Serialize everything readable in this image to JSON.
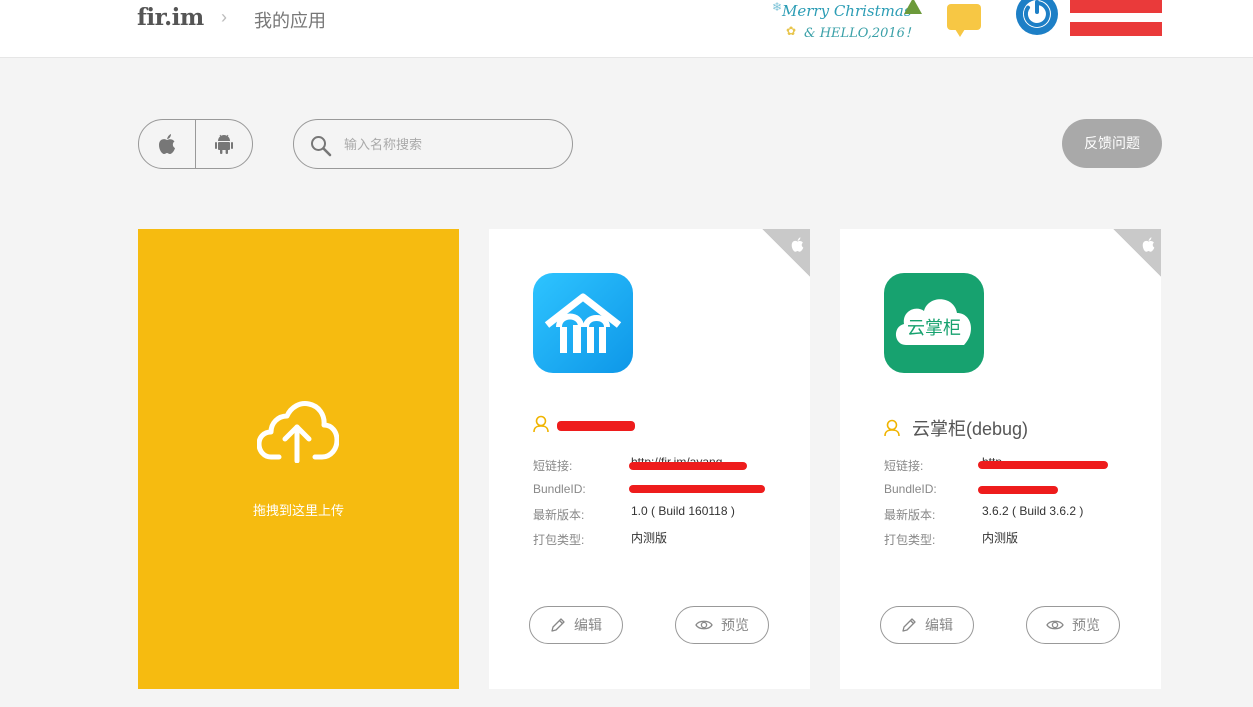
{
  "header": {
    "logo": "fir.im",
    "separator": "›",
    "title": "我的应用",
    "banner": {
      "line1": "Merry Christmas",
      "line2": "& HELLO,2016！"
    }
  },
  "filter": {
    "platforms": [
      {
        "name": "ios",
        "icon": "apple-icon"
      },
      {
        "name": "android",
        "icon": "android-icon"
      }
    ],
    "search_placeholder": "输入名称搜索",
    "feedback_label": "反馈问题"
  },
  "upload": {
    "label": "拖拽到这里上传"
  },
  "labels": {
    "short_link": "短链接:",
    "bundle_id": "BundleID:",
    "latest_version": "最新版本:",
    "build_type": "打包类型:",
    "edit": "编辑",
    "preview": "预览"
  },
  "apps": [
    {
      "name": "",
      "platform": "ios",
      "short_link": "http://fir.im/ayang",
      "bundle_id": "",
      "version": "1.0 ( Build 160118 )",
      "build_type": "内测版",
      "icon_color": "#20b3f2"
    },
    {
      "name": "云掌柜(debug)",
      "platform": "ios",
      "short_link": "http",
      "bundle_id": "",
      "version": "3.6.2 ( Build 3.6.2 )",
      "build_type": "内测版",
      "icon_color": "#17a26f",
      "icon_text": "云掌柜"
    }
  ],
  "colors": {
    "upload_bg": "#f6bb10",
    "feedback_bg": "#a9a9a9",
    "person_icon": "#f0b400",
    "redaction": "#ee1c1c"
  }
}
